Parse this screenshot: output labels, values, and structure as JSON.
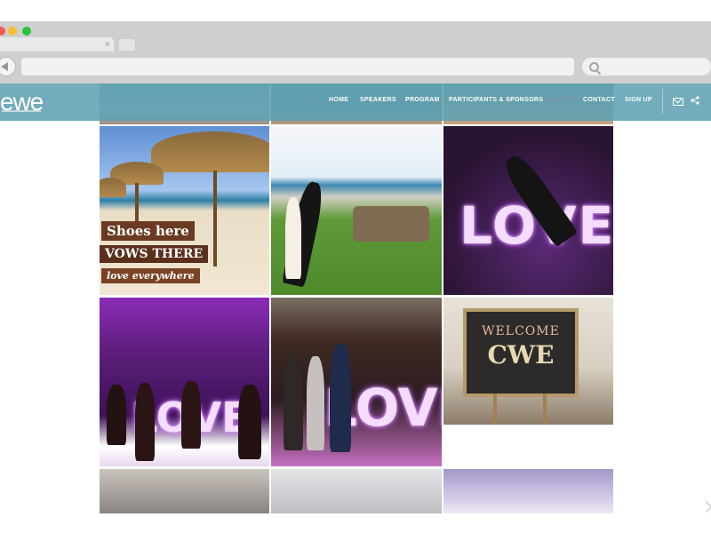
{
  "browser": {
    "colors": {
      "red": "#f25d50",
      "yellow": "#f6be2f",
      "green": "#29c33b"
    },
    "tab": {
      "close_glyph": "×"
    }
  },
  "site": {
    "logo": "ewe",
    "brand_color": "#60a0b0",
    "nav": [
      {
        "label": "HOME",
        "active": false
      },
      {
        "label": "SPEAKERS",
        "active": false
      },
      {
        "label": "PROGRAM",
        "active": false
      },
      {
        "label": "PARTICIPANTS & SPONSORS",
        "active": false
      },
      {
        "label": "GALLERY",
        "active": true
      },
      {
        "label": "CONTACT",
        "active": false
      },
      {
        "label": "SIGN UP",
        "active": false
      }
    ],
    "icons": [
      "mail-icon",
      "share-icon"
    ]
  },
  "gallery": {
    "beach_signs": [
      "Shoes here",
      "VOWS THERE",
      "love everywhere"
    ],
    "love_sign": "LOVE",
    "welcome_sign": {
      "line1": "WELCOME",
      "line2": "CWE"
    }
  }
}
